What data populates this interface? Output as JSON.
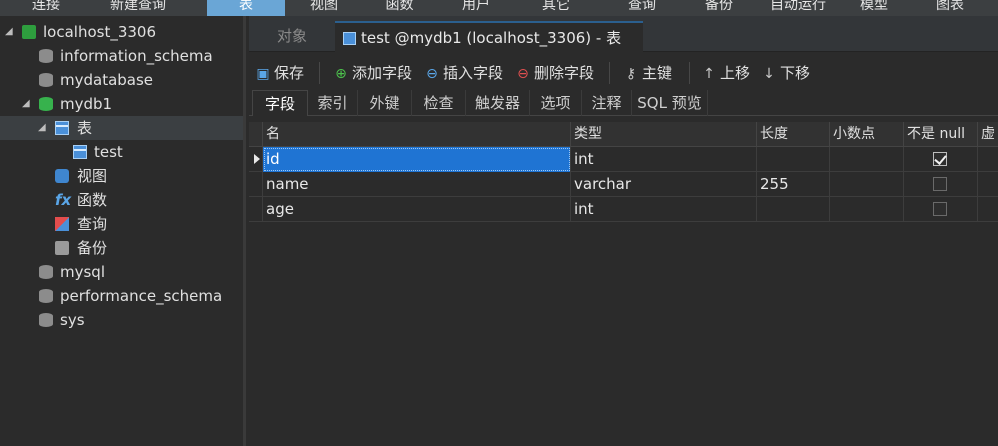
{
  "menubar": {
    "items": [
      {
        "label": "连接"
      },
      {
        "label": "新建查询"
      },
      {
        "label": "表"
      },
      {
        "label": "视图"
      },
      {
        "label": "函数"
      },
      {
        "label": "用户"
      },
      {
        "label": "其它"
      },
      {
        "label": "查询"
      },
      {
        "label": "备份"
      },
      {
        "label": "自动运行"
      },
      {
        "label": "模型"
      },
      {
        "label": "图表"
      }
    ],
    "active_index": 2
  },
  "sidebar": {
    "nodes": [
      {
        "label": "localhost_3306",
        "icon": "connection-icon"
      },
      {
        "label": "information_schema",
        "icon": "database-icon"
      },
      {
        "label": "mydatabase",
        "icon": "database-icon"
      },
      {
        "label": "mydb1",
        "icon": "database-open-icon"
      },
      {
        "label": "表",
        "icon": "tables-icon"
      },
      {
        "label": "test",
        "icon": "table-icon"
      },
      {
        "label": "视图",
        "icon": "views-icon"
      },
      {
        "label": "函数",
        "icon": "functions-icon"
      },
      {
        "label": "查询",
        "icon": "queries-icon"
      },
      {
        "label": "备份",
        "icon": "backups-icon"
      },
      {
        "label": "mysql",
        "icon": "database-icon"
      },
      {
        "label": "performance_schema",
        "icon": "database-icon"
      },
      {
        "label": "sys",
        "icon": "database-icon"
      }
    ],
    "fx_glyph": "fx"
  },
  "tabs": {
    "objects": "对象",
    "design": "test @mydb1 (localhost_3306) - 表"
  },
  "toolbar": {
    "save": "保存",
    "add_field": "添加字段",
    "insert_field": "插入字段",
    "delete_field": "删除字段",
    "primary_key": "主键",
    "move_up": "上移",
    "move_down": "下移"
  },
  "subtabs": [
    "字段",
    "索引",
    "外键",
    "检查",
    "触发器",
    "选项",
    "注释",
    "SQL 预览"
  ],
  "grid": {
    "columns": [
      "名",
      "类型",
      "长度",
      "小数点",
      "不是 null",
      "虚"
    ],
    "rows": [
      {
        "name": "id",
        "type": "int",
        "length": "",
        "decimals": "",
        "not_null": true
      },
      {
        "name": "name",
        "type": "varchar",
        "length": "255",
        "decimals": "",
        "not_null": false
      },
      {
        "name": "age",
        "type": "int",
        "length": "",
        "decimals": "",
        "not_null": false
      }
    ]
  },
  "colors": {
    "accent": "#1f74d3",
    "active_menu": "#6aa6d6",
    "background": "#2b2b2b"
  }
}
